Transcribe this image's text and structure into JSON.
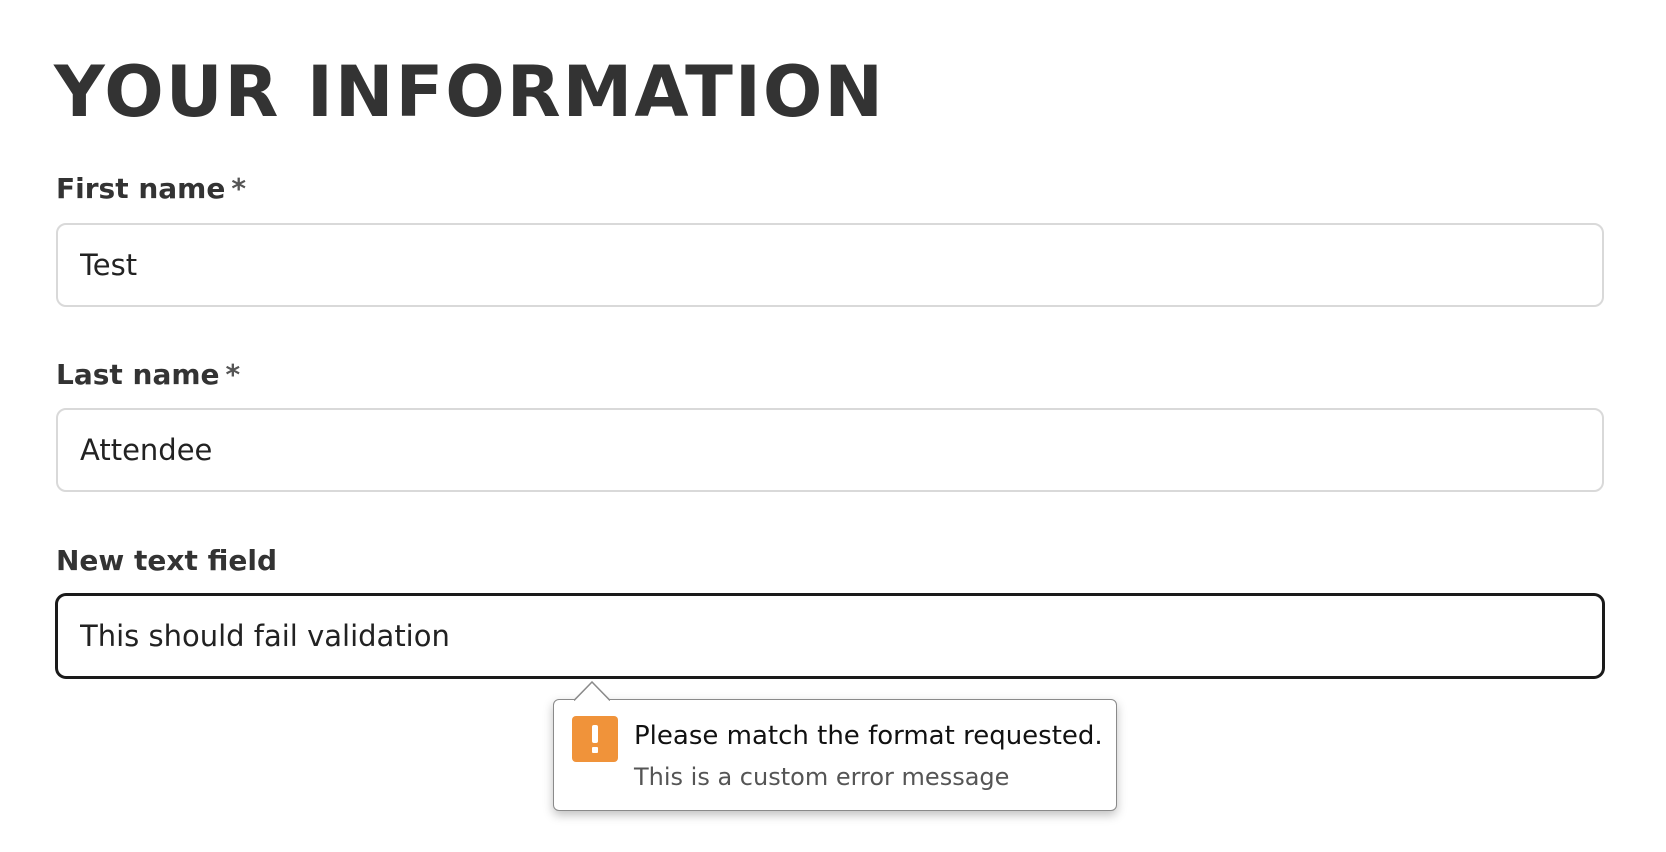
{
  "page": {
    "title": "YOUR INFORMATION"
  },
  "form": {
    "fields": [
      {
        "label": "First name",
        "required_mark": "*",
        "value": "Test"
      },
      {
        "label": "Last name",
        "required_mark": "*",
        "value": "Attendee"
      },
      {
        "label": "New text field",
        "value": "This should fail validation"
      }
    ]
  },
  "validation_tooltip": {
    "icon": "warning-icon",
    "icon_color": "#f0933a",
    "message": "Please match the format requested.",
    "detail": "This is a custom error message"
  },
  "colors": {
    "focused_border": "#1a1a1a",
    "input_border": "#d9d9d9",
    "text": "#333333"
  }
}
